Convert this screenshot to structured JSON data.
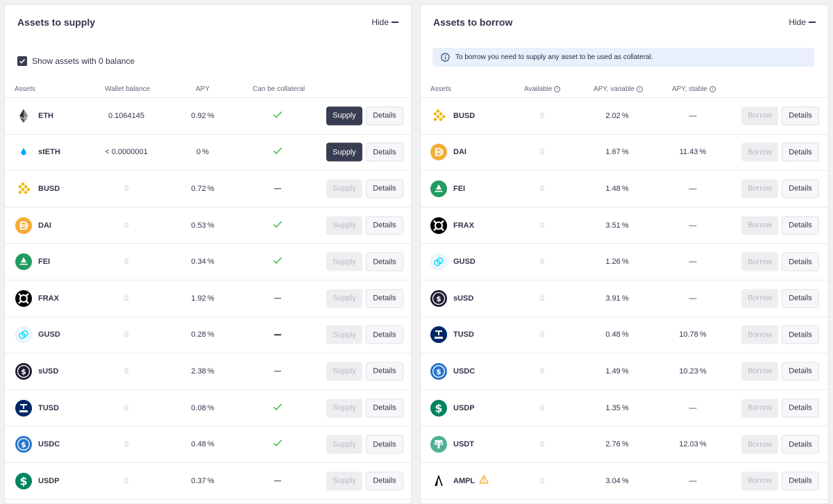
{
  "supply": {
    "title": "Assets to supply",
    "hide_label": "Hide",
    "checkbox_label": "Show assets with 0 balance",
    "columns": {
      "asset": "Assets",
      "wallet": "Wallet balance",
      "apy": "APY",
      "collateral": "Can be collateral"
    },
    "rows": [
      {
        "name": "ETH",
        "icon": "ethereum-icon",
        "balance": "0.1064145",
        "apy": "0.92",
        "collateral": "check",
        "supply": "Supply",
        "details": "Details"
      },
      {
        "name": "stETH",
        "icon": "steth-icon",
        "balance": "< 0.0000001",
        "apy": "0",
        "collateral": "check",
        "supply": "Supply",
        "details": "Details"
      },
      {
        "name": "BUSD",
        "icon": "busd-icon",
        "balance": "0",
        "apy": "0.72",
        "collateral": "dash",
        "supply": "Supply",
        "details": "Details"
      },
      {
        "name": "DAI",
        "icon": "dai-icon",
        "balance": "0",
        "apy": "0.53",
        "collateral": "check",
        "supply": "Supply",
        "details": "Details"
      },
      {
        "name": "FEI",
        "icon": "fei-icon",
        "balance": "0",
        "apy": "0.34",
        "collateral": "check",
        "supply": "Supply",
        "details": "Details"
      },
      {
        "name": "FRAX",
        "icon": "frax-icon",
        "balance": "0",
        "apy": "1.92",
        "collateral": "dash",
        "supply": "Supply",
        "details": "Details"
      },
      {
        "name": "GUSD",
        "icon": "gusd-icon",
        "balance": "0",
        "apy": "0.28",
        "collateral": "dash",
        "supply": "Supply",
        "details": "Details"
      },
      {
        "name": "sUSD",
        "icon": "susd-icon",
        "balance": "0",
        "apy": "2.38",
        "collateral": "dash",
        "supply": "Supply",
        "details": "Details"
      },
      {
        "name": "TUSD",
        "icon": "tusd-icon",
        "balance": "0",
        "apy": "0.08",
        "collateral": "check",
        "supply": "Supply",
        "details": "Details"
      },
      {
        "name": "USDC",
        "icon": "usdc-icon",
        "balance": "0",
        "apy": "0.48",
        "collateral": "check",
        "supply": "Supply",
        "details": "Details"
      },
      {
        "name": "USDP",
        "icon": "usdp-icon",
        "balance": "0",
        "apy": "0.37",
        "collateral": "dash",
        "supply": "Supply",
        "details": "Details"
      }
    ]
  },
  "borrow": {
    "title": "Assets to borrow",
    "hide_label": "Hide",
    "info_text": "To borrow you need to supply any asset to be used as collateral.",
    "columns": {
      "asset": "Assets",
      "available": "Available",
      "apy_variable": "APY, variable",
      "apy_stable": "APY, stable"
    },
    "rows": [
      {
        "name": "BUSD",
        "icon": "busd-icon",
        "available": "0",
        "variable": "2.02",
        "stable": "—",
        "borrow": "Borrow",
        "details": "Details"
      },
      {
        "name": "DAI",
        "icon": "dai-icon",
        "available": "0",
        "variable": "1.67",
        "stable": "11.43",
        "borrow": "Borrow",
        "details": "Details"
      },
      {
        "name": "FEI",
        "icon": "fei-icon",
        "available": "0",
        "variable": "1.48",
        "stable": "—",
        "borrow": "Borrow",
        "details": "Details"
      },
      {
        "name": "FRAX",
        "icon": "frax-icon",
        "available": "0",
        "variable": "3.51",
        "stable": "—",
        "borrow": "Borrow",
        "details": "Details"
      },
      {
        "name": "GUSD",
        "icon": "gusd-icon",
        "available": "0",
        "variable": "1.26",
        "stable": "—",
        "borrow": "Borrow",
        "details": "Details"
      },
      {
        "name": "sUSD",
        "icon": "susd-icon",
        "available": "0",
        "variable": "3.91",
        "stable": "—",
        "borrow": "Borrow",
        "details": "Details"
      },
      {
        "name": "TUSD",
        "icon": "tusd-icon",
        "available": "0",
        "variable": "0.48",
        "stable": "10.78",
        "borrow": "Borrow",
        "details": "Details"
      },
      {
        "name": "USDC",
        "icon": "usdc-icon",
        "available": "0",
        "variable": "1.49",
        "stable": "10.23",
        "borrow": "Borrow",
        "details": "Details"
      },
      {
        "name": "USDP",
        "icon": "usdp-icon",
        "available": "0",
        "variable": "1.35",
        "stable": "—",
        "borrow": "Borrow",
        "details": "Details"
      },
      {
        "name": "USDT",
        "icon": "usdt-icon",
        "available": "0",
        "variable": "2.76",
        "stable": "12.03",
        "borrow": "Borrow",
        "details": "Details"
      },
      {
        "name": "AMPL",
        "icon": "ampl-icon",
        "available": "0",
        "variable": "3.04",
        "stable": "—",
        "borrow": "Borrow",
        "details": "Details",
        "warning": true
      }
    ]
  },
  "percent_sign": "%"
}
